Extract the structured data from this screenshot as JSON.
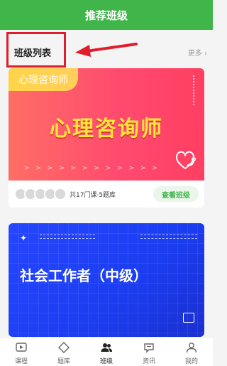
{
  "header": {
    "title": "推荐班级"
  },
  "section": {
    "title": "班级列表",
    "more_label": "更多"
  },
  "cards": [
    {
      "tag": "心理咨询师",
      "title": "心理咨询师",
      "chevrons": "> > > > > > > > > > > >",
      "meta": "共17门课·5题库",
      "action_label": "查看班级"
    },
    {
      "title": "社会工作者（中级）"
    }
  ],
  "tabbar": {
    "items": [
      {
        "label": "课程",
        "icon": "play-square-icon"
      },
      {
        "label": "题库",
        "icon": "diamond-icon"
      },
      {
        "label": "班级",
        "icon": "people-icon",
        "active": true
      },
      {
        "label": "资讯",
        "icon": "chat-bubble-icon"
      },
      {
        "label": "我的",
        "icon": "person-icon"
      }
    ]
  },
  "colors": {
    "brand_green": "#3fb54a",
    "annotation_red": "#e11d2c",
    "card1_red": "#ff4b6f",
    "card1_title_yellow": "#ffe53b",
    "card2_blue": "#2646ff"
  }
}
